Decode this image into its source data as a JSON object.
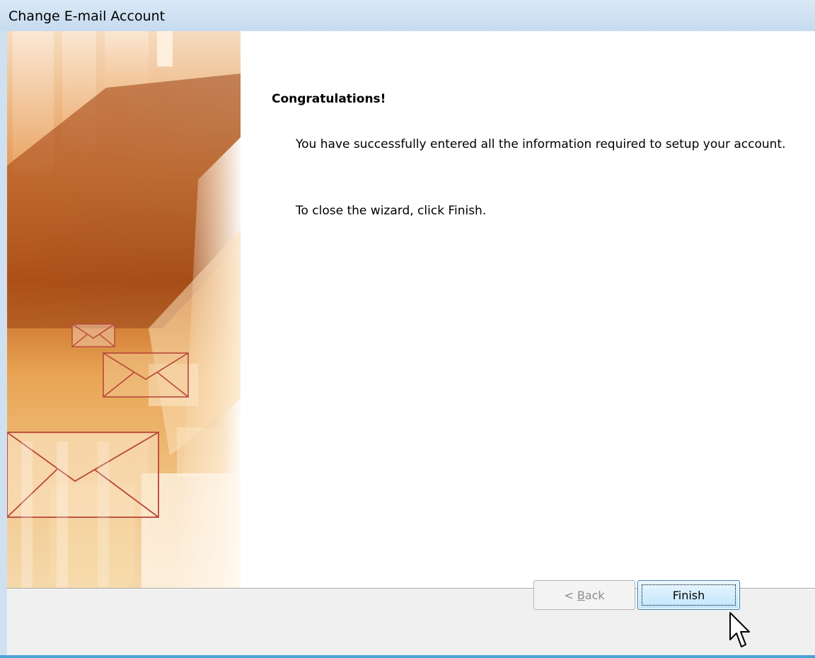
{
  "window": {
    "title": "Change E-mail Account"
  },
  "content": {
    "heading": "Congratulations!",
    "paragraph1": "You have successfully entered all the information required to setup your account.",
    "paragraph2": "To close the wizard, click Finish."
  },
  "buttons": {
    "back_prefix": "< ",
    "back_accel": "B",
    "back_rest": "ack",
    "back_enabled": false,
    "finish_label": "Finish"
  },
  "colors": {
    "banner_primary": "#c8641e",
    "banner_highlight": "#f3c98c",
    "envelope_stroke": "#b8463a",
    "finish_border": "#3c7fb1"
  },
  "icons": {
    "banner": [
      "envelope-icon",
      "envelope-icon",
      "envelope-icon"
    ],
    "cursor": "mouse-pointer-icon"
  }
}
